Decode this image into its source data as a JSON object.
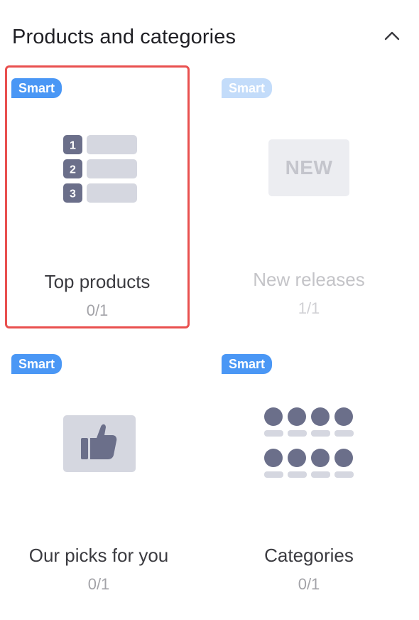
{
  "section": {
    "title": "Products and categories"
  },
  "icons": {
    "collapse": "chevron-up-icon",
    "top_products": "ranked-list-icon",
    "new_releases": "new-tag-icon",
    "our_picks": "thumbs-up-icon",
    "categories": "category-grid-icon"
  },
  "colors": {
    "badge": "#4a97f5",
    "badge_disabled": "#c3dcfa",
    "selected_border": "#e9504f",
    "illustration_dark": "#6b6f8a",
    "illustration_light": "#d5d7e0"
  },
  "cards": [
    {
      "badge": "Smart",
      "name": "Top products",
      "count": "0/1",
      "selected": true,
      "enabled": true,
      "rank_numbers": [
        "1",
        "2",
        "3"
      ]
    },
    {
      "badge": "Smart",
      "name": "New releases",
      "count": "1/1",
      "selected": false,
      "enabled": false,
      "illustration_text": "NEW"
    },
    {
      "badge": "Smart",
      "name": "Our picks for you",
      "count": "0/1",
      "selected": false,
      "enabled": true
    },
    {
      "badge": "Smart",
      "name": "Categories",
      "count": "0/1",
      "selected": false,
      "enabled": true
    }
  ]
}
